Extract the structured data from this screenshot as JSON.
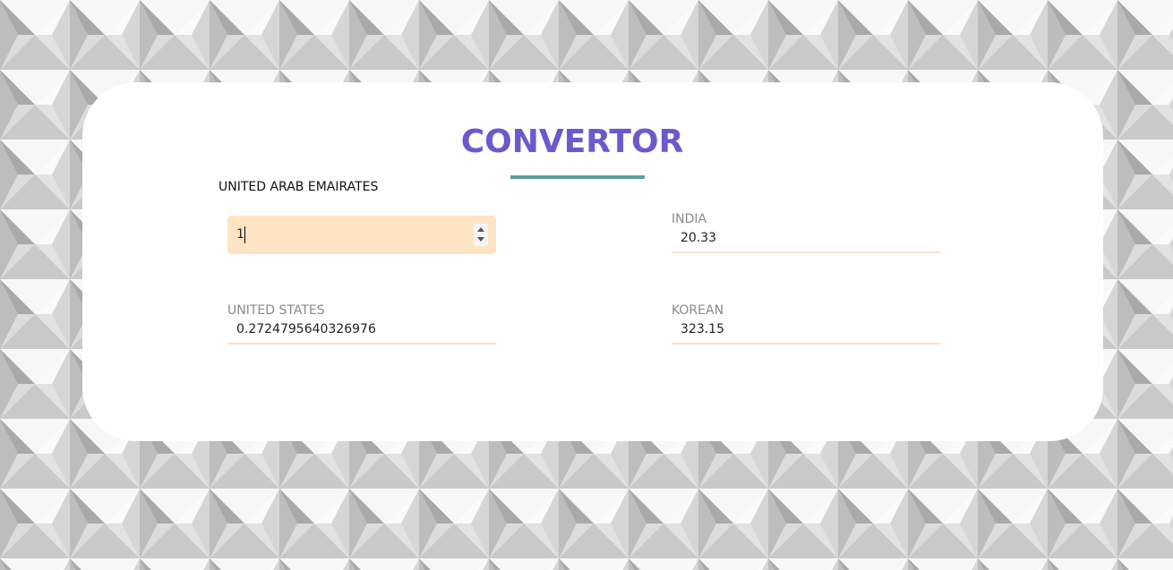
{
  "app": {
    "title": "CONVERTOR"
  },
  "source": {
    "label": "UNITED ARAB EMAIRATES",
    "value": "1"
  },
  "outputs": {
    "india": {
      "label": "INDIA",
      "value": "20.33"
    },
    "united_states": {
      "label": "UNITED STATES",
      "value": "0.2724795640326976"
    },
    "korean": {
      "label": "KOREAN",
      "value": "323.15"
    }
  },
  "colors": {
    "title": "#6a5acd",
    "underline": "#5f9ea0",
    "input_bg": "#ffe4c4",
    "field_border": "#fae3c8",
    "card_bg": "#ffffff"
  },
  "icons": {
    "spinner": "number-spinner-icon"
  }
}
